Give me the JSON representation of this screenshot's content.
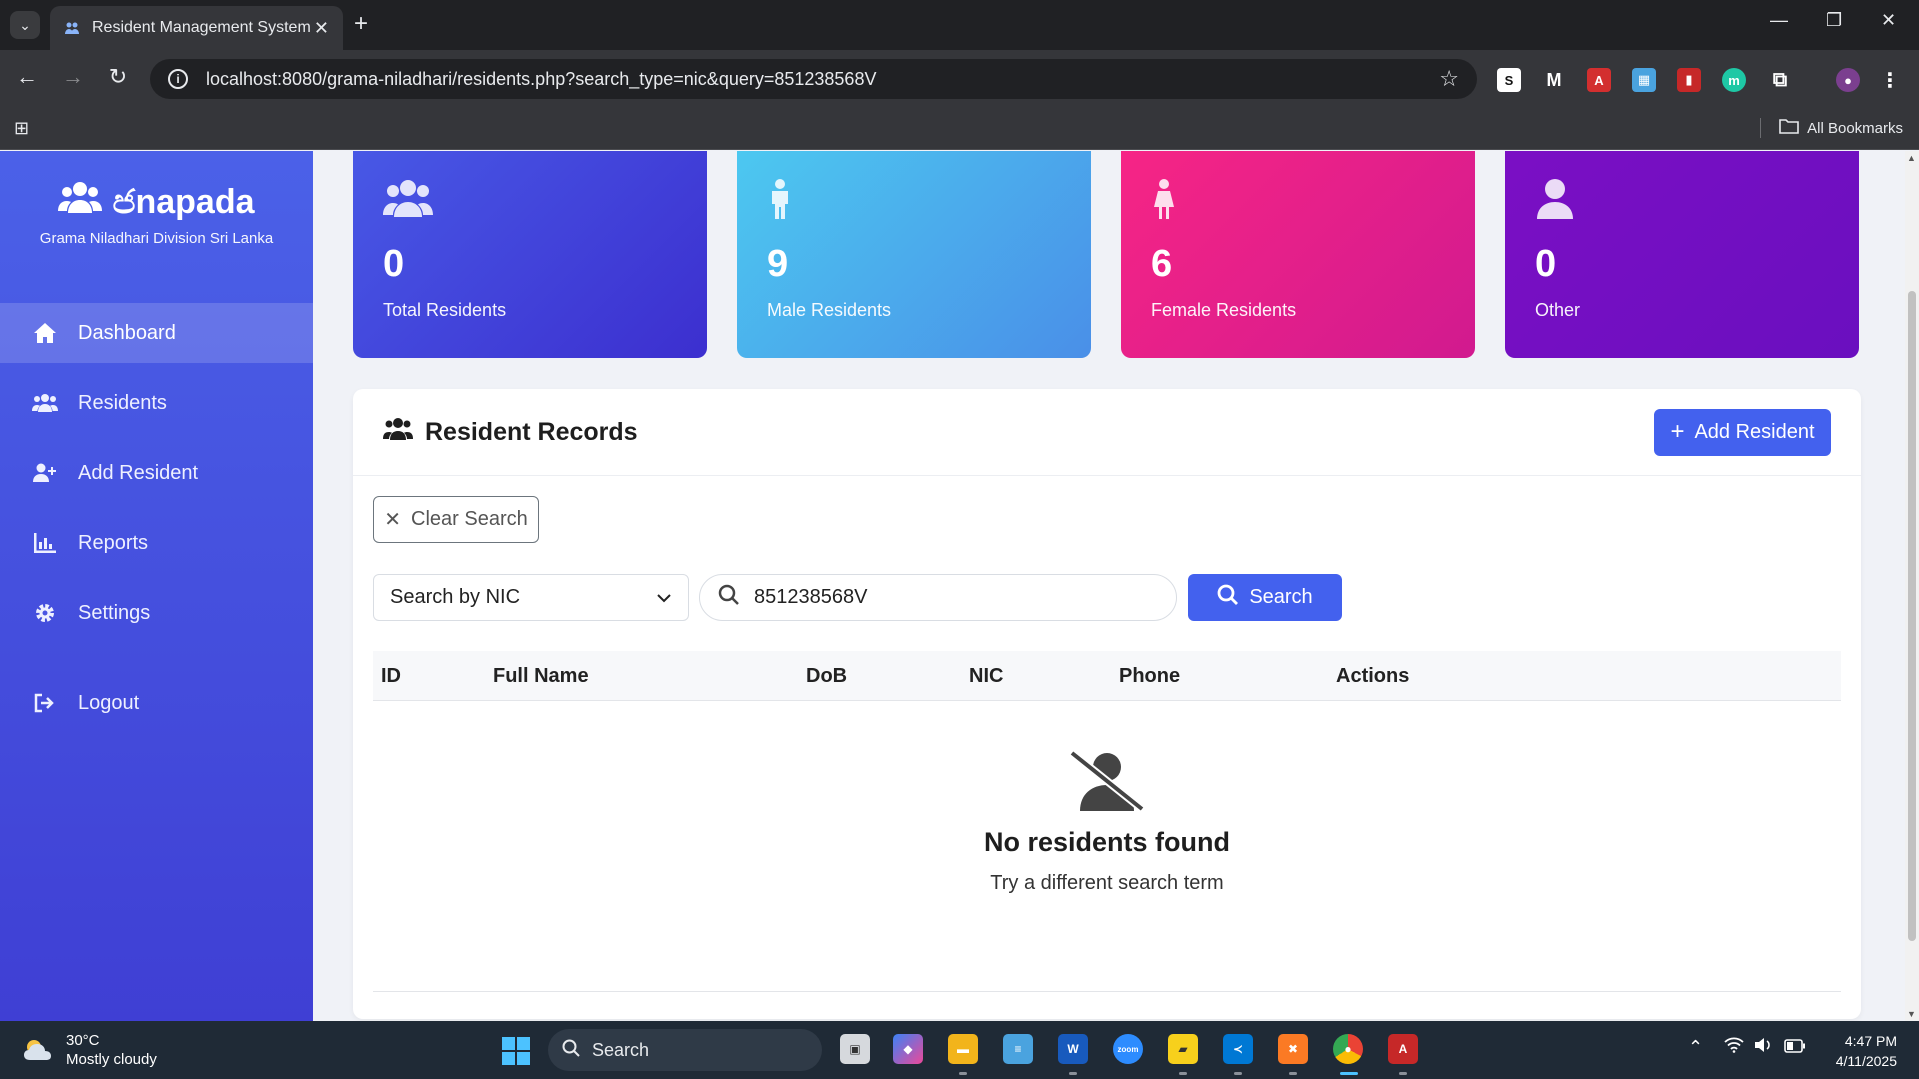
{
  "browser": {
    "tab_title": "Resident Management System",
    "url": "localhost:8080/grama-niladhari/residents.php?search_type=nic&query=851238568V",
    "bookmarks_label": "All Bookmarks"
  },
  "sidebar": {
    "brand": "Janapada",
    "brand_display": "ජnapada",
    "subtitle": "Grama Niladhari Division Sri Lanka",
    "items": [
      {
        "label": "Dashboard",
        "icon": "home-icon",
        "active": true
      },
      {
        "label": "Residents",
        "icon": "users-icon"
      },
      {
        "label": "Add Resident",
        "icon": "user-plus-icon"
      },
      {
        "label": "Reports",
        "icon": "chart-icon"
      },
      {
        "label": "Settings",
        "icon": "gear-icon"
      },
      {
        "label": "Logout",
        "icon": "sign-out-icon"
      }
    ]
  },
  "stats": [
    {
      "value": "0",
      "label": "Total Residents",
      "color": "#4361ee"
    },
    {
      "value": "9",
      "label": "Male Residents",
      "color": "#4cc9f0"
    },
    {
      "value": "6",
      "label": "Female Residents",
      "color": "#f72585"
    },
    {
      "value": "0",
      "label": "Other",
      "color": "#7209b7"
    }
  ],
  "records": {
    "title": "Resident Records",
    "add_button": "Add Resident",
    "clear_button": "Clear Search",
    "search_type": "Search by NIC",
    "search_value": "851238568V",
    "search_button": "Search",
    "columns": [
      "ID",
      "Full Name",
      "DoB",
      "NIC",
      "Phone",
      "Actions"
    ],
    "empty_title": "No residents found",
    "empty_subtitle": "Try a different search term"
  },
  "taskbar": {
    "temperature": "30°C",
    "weather": "Mostly cloudy",
    "search_label": "Search",
    "time": "4:47 PM",
    "date": "4/11/2025"
  }
}
